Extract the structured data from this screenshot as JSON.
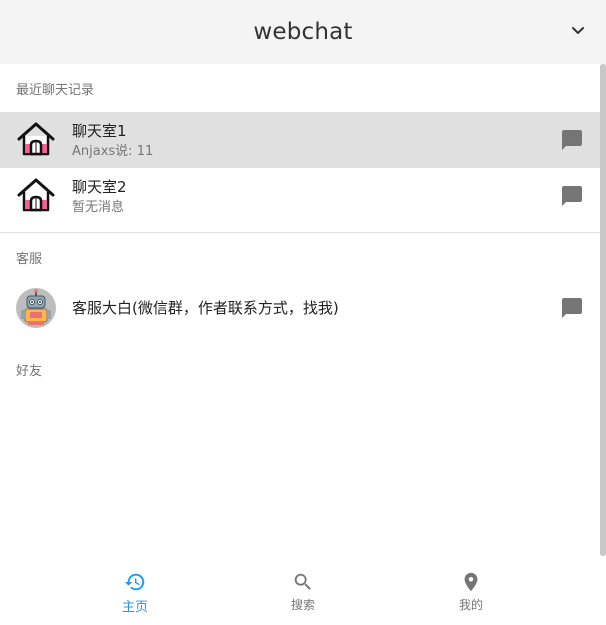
{
  "header": {
    "title": "webchat",
    "menu_icon": "chevron-down-icon"
  },
  "sections": {
    "recent": {
      "label": "最近聊天记录",
      "items": [
        {
          "name": "聊天室1",
          "preview": "Anjaxs说: 11",
          "icon": "house-icon",
          "action_icon": "message-icon"
        },
        {
          "name": "聊天室2",
          "preview": "暂无消息",
          "icon": "house-icon",
          "action_icon": "message-icon"
        }
      ]
    },
    "support": {
      "label": "客服",
      "items": [
        {
          "name": "客服大白(微信群，作者联系方式，找我)",
          "icon": "robot-avatar",
          "action_icon": "message-icon"
        }
      ]
    },
    "friends": {
      "label": "好友",
      "items": []
    }
  },
  "bottom_nav": {
    "items": [
      {
        "label": "主页",
        "icon": "history-icon",
        "active": true
      },
      {
        "label": "搜索",
        "icon": "search-icon",
        "active": false
      },
      {
        "label": "我的",
        "icon": "location-pin-icon",
        "active": false
      }
    ]
  },
  "colors": {
    "accent": "#2196f3",
    "selected_row": "#e0e0e0",
    "header_bg": "#f4f4f4",
    "icon_gray": "#757575",
    "house_pink": "#f06292"
  }
}
